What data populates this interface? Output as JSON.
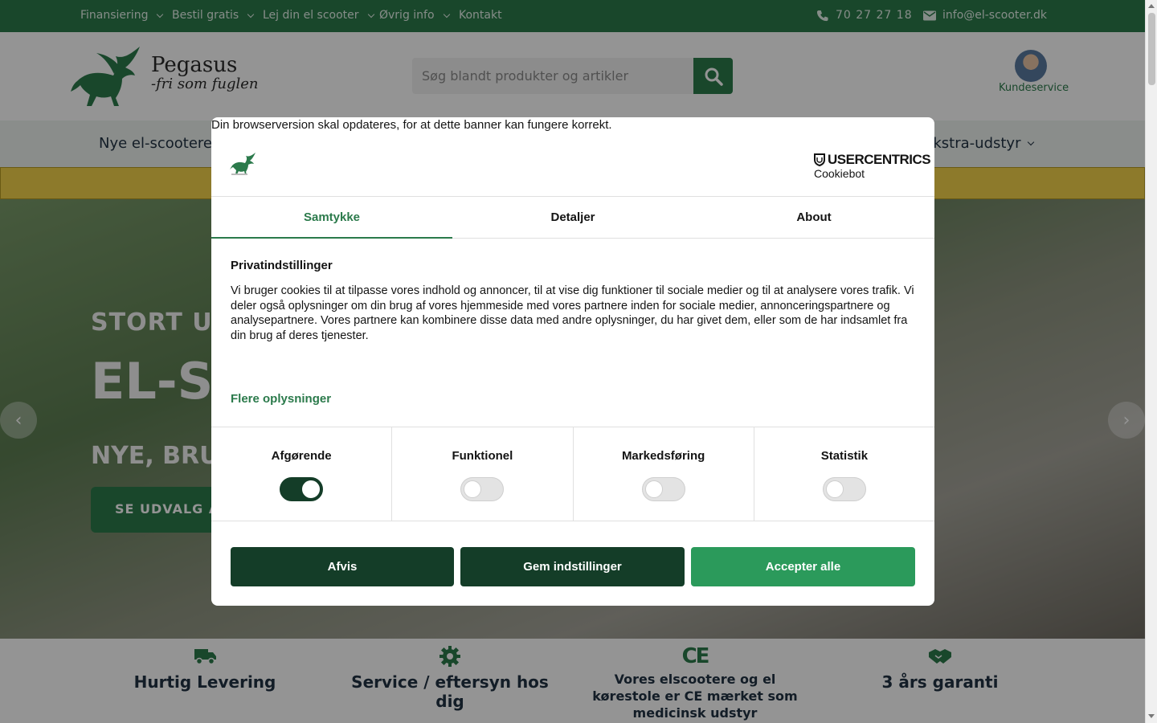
{
  "topbar": {
    "menu": [
      "Finansiering",
      "Bestil gratis",
      "Lej din el scooter",
      "Øvrig info",
      "Kontakt"
    ],
    "phone": "70 27 27 18",
    "email": "info@el-scooter.dk"
  },
  "header": {
    "logo_name": "Pegasus",
    "logo_tagline": "-fri som fuglen",
    "search_placeholder": "Søg blandt produkter og artikler",
    "customer_service": "Kundeservice"
  },
  "nav": {
    "first_item": "Nye el-scootere",
    "last_item": "Ekstra-udstyr"
  },
  "hero": {
    "line1": "STORT UDV",
    "line2": "EL-SC",
    "line3": "NYE, BRUG",
    "cta": "SE UDVALG A"
  },
  "features": [
    {
      "icon": "truck-icon",
      "label": "Hurtig Levering"
    },
    {
      "icon": "gear-icon",
      "label": "Service / eftersyn hos dig"
    },
    {
      "icon": "ce-mark-icon",
      "label": "Vores elscootere og el kørestole er CE mærket som medicinsk udstyr"
    },
    {
      "icon": "handshake-icon",
      "label": "3 års garanti"
    }
  ],
  "consent": {
    "browser_note": "Din browserversion skal opdateres, for at dette banner kan fungere korrekt.",
    "provider": "USERCENTRICS",
    "provider_sub": "Cookiebot",
    "tabs": [
      "Samtykke",
      "Detaljer",
      "About"
    ],
    "active_tab": "Samtykke",
    "title": "Privatindstillinger",
    "body": "Vi bruger cookies til at tilpasse vores indhold og annoncer, til at vise dig funktioner til sociale medier og til at analysere vores trafik. Vi deler også oplysninger om din brug af vores hjemmeside med vores partnere inden for sociale medier, annonceringspartnere og analysepartnere. Vores partnere kan kombinere disse data med andre oplysninger, du har givet dem, eller som de har indsamlet fra din brug af deres tjenester.",
    "more_link": "Flere oplysninger",
    "categories": [
      {
        "label": "Afgørende",
        "enabled": true
      },
      {
        "label": "Funktionel",
        "enabled": false
      },
      {
        "label": "Markedsføring",
        "enabled": false
      },
      {
        "label": "Statistik",
        "enabled": false
      }
    ],
    "buttons": {
      "reject": "Afvis",
      "save": "Gem indstillinger",
      "accept": "Accepter alle"
    }
  },
  "colors": {
    "brand_green": "#2b7a4b",
    "dark_green": "#143d28",
    "notice_yellow": "#f3d24a"
  }
}
